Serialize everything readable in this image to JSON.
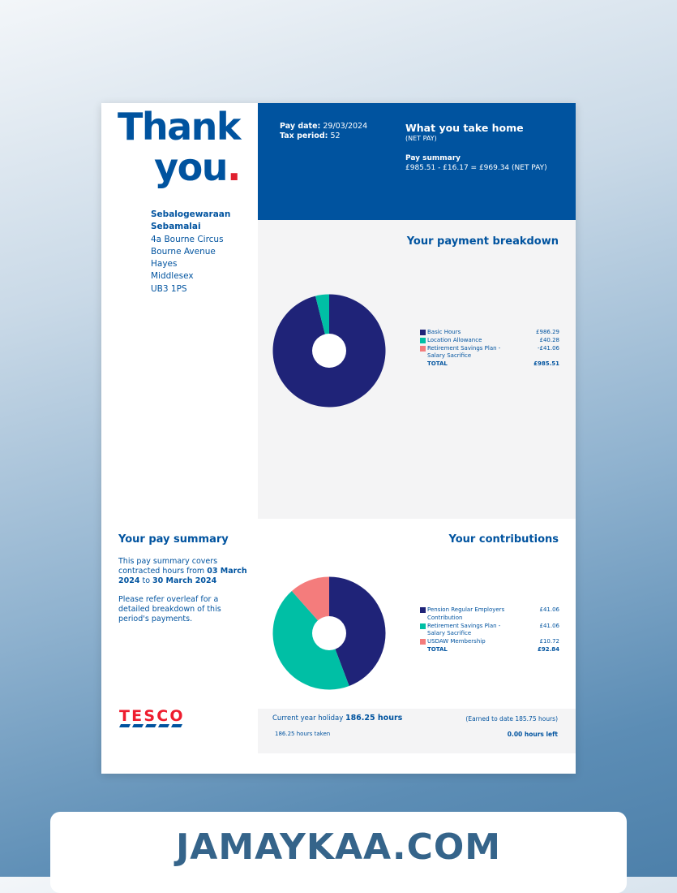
{
  "header": {
    "thank": "Thank",
    "you": "you",
    "dot": "."
  },
  "address": {
    "name1": "Sebalogewaraan",
    "name2": "Sebamalai",
    "line1": "4a Bourne Circus",
    "line2": "Bourne Avenue",
    "line3": "Hayes",
    "line4": "Middlesex",
    "line5": "UB3 1PS"
  },
  "pay_info": {
    "pay_date_label": "Pay date:",
    "pay_date": "29/03/2024",
    "tax_period_label": "Tax period:",
    "tax_period": "52",
    "take_home_title": "What you take home",
    "take_home_sub": "(NET PAY)",
    "pay_summary_title": "Pay summary",
    "pay_summary_calc": "£985.51 - £16.17 = £969.34 (NET PAY)"
  },
  "payment_breakdown": {
    "title": "Your payment breakdown",
    "items": [
      {
        "label": "Basic Hours",
        "amount": "£986.29",
        "color": "#1f2378"
      },
      {
        "label": "Location Allowance",
        "amount": "£40.28",
        "color": "#00bfa5"
      },
      {
        "label": "Retirement Savings Plan - Salary Sacrifice",
        "amount": "-£41.06",
        "color": "#f47c7c"
      }
    ],
    "total_label": "TOTAL",
    "total_amount": "£985.51"
  },
  "pay_summary": {
    "title": "Your pay summary",
    "text1_a": "This pay summary covers contracted hours from ",
    "text1_b": "03 March 2024",
    "text1_c": " to ",
    "text1_d": "30 March 2024",
    "text2": "Please refer overleaf for a detailed breakdown of this period's payments."
  },
  "contributions": {
    "title": "Your contributions",
    "items": [
      {
        "label": "Pension Regular Employers Contribution",
        "amount": "£41.06",
        "color": "#1f2378"
      },
      {
        "label": "Retirement Savings Plan - Salary Sacrifice",
        "amount": "£41.06",
        "color": "#00bfa5"
      },
      {
        "label": "USDAW Membership",
        "amount": "£10.72",
        "color": "#f47c7c"
      }
    ],
    "total_label": "TOTAL",
    "total_amount": "£92.84"
  },
  "holiday": {
    "current_label": "Current year holiday",
    "current_value": "186.25 hours",
    "earned": "(Earned to date 185.75 hours)",
    "taken": "186.25 hours taken",
    "left": "0.00 hours left"
  },
  "logo_text": "TESCO",
  "watermark": "JAMAYKAA.COM",
  "chart_data": [
    {
      "type": "pie",
      "title": "Your payment breakdown",
      "categories": [
        "Basic Hours",
        "Location Allowance"
      ],
      "values": [
        986.29,
        40.28
      ],
      "colors": [
        "#1f2378",
        "#00bfa5"
      ]
    },
    {
      "type": "pie",
      "title": "Your contributions",
      "categories": [
        "Pension Regular Employers Contribution",
        "Retirement Savings Plan - Salary Sacrifice",
        "USDAW Membership"
      ],
      "values": [
        41.06,
        41.06,
        10.72
      ],
      "colors": [
        "#1f2378",
        "#00bfa5",
        "#f47c7c"
      ]
    }
  ]
}
